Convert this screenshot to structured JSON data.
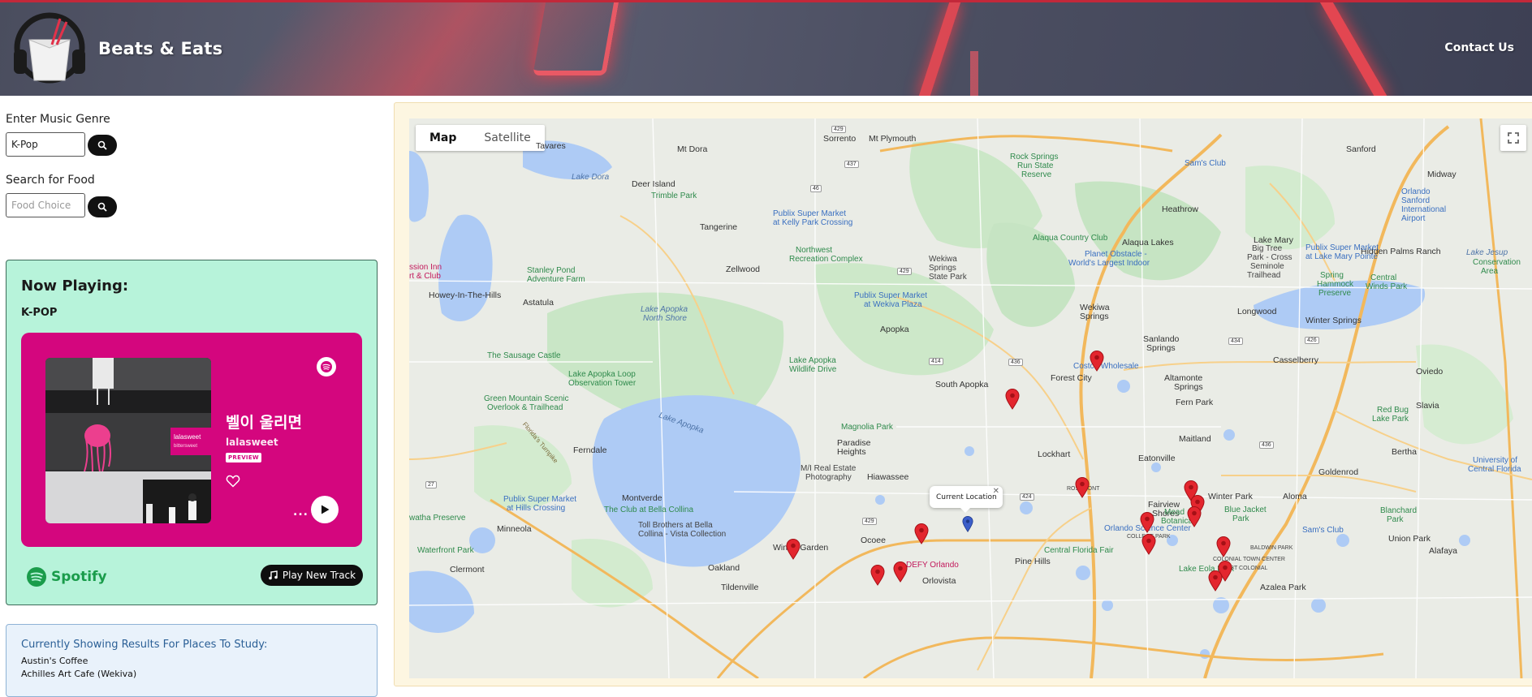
{
  "header": {
    "brand": "Beats & Eats",
    "contact": "Contact Us"
  },
  "sidebar": {
    "genre_label": "Enter Music Genre",
    "genre_value": "K-Pop",
    "food_label": "Search for Food",
    "food_placeholder": "Food Choice"
  },
  "now_playing": {
    "title": "Now Playing:",
    "genre": "K-POP",
    "track": "벨이 울리면",
    "artist": "lalasweet",
    "preview_badge": "PREVIEW",
    "album_text_1": "lalasweet",
    "album_text_2": "bittersweet",
    "more": "...",
    "spotify_brand": "Spotify",
    "play_new": "Play New Track"
  },
  "results": {
    "title": "Currently Showing Results For Places To Study:",
    "items": [
      "Austin's Coffee",
      "Achilles Art Cafe (Wekiva)"
    ]
  },
  "map": {
    "type_map": "Map",
    "type_satellite": "Satellite",
    "info_window": "Current Location",
    "info_close": "✕",
    "colors": {
      "water": "#aecbf5",
      "park": "#c4e3c4",
      "highway": "#f5c06a",
      "pin": "#e3262e"
    }
  },
  "map_labels": {
    "tavares": "Tavares",
    "mt_dora": "Mt Dora",
    "sorrento": "Sorrento",
    "mt_plymouth": "Mt Plymouth",
    "sanford": "Sanford",
    "midway": "Midway",
    "lake_dora": "Lake Dora",
    "deer_island": "Deer Island",
    "trimble_park": "Trimble Park",
    "tangerine": "Tangerine",
    "publix_kelly_1": "Publix Super Market",
    "publix_kelly_2": "at Kelly Park Crossing",
    "heathrow": "Heathrow",
    "rock_springs_1": "Rock Springs",
    "rock_springs_2": "Run State",
    "rock_springs_3": "Reserve",
    "sams_club": "Sam's Club",
    "sanford_airport_1": "Orlando",
    "sanford_airport_2": "Sanford",
    "sanford_airport_3": "International",
    "sanford_airport_4": "Airport",
    "alaqua_lakes": "Alaqua Lakes",
    "lake_mary": "Lake Mary",
    "hidden_palms": "Hidden Palms Ranch",
    "lake_jesup_1": "Lake Jesup",
    "lake_jesup_2": "Conservation",
    "lake_jesup_3": "Area",
    "zellwood": "Zellwood",
    "northwest_rec_1": "Northwest",
    "northwest_rec_2": "Recreation Complex",
    "alaqua_cc": "Alaqua Country Club",
    "wekiwa_1": "Wekiwa",
    "wekiwa_2": "Springs",
    "wekiwa_3": "State Park",
    "planet_obstacle_1": "Planet Obstacle -",
    "planet_obstacle_2": "World's Largest Indoor",
    "big_tree_1": "Big Tree",
    "big_tree_2": "Park - Cross",
    "big_tree_3": "Seminole",
    "big_tree_4": "Trailhead",
    "publix_lakemary_1": "Publix Super Market",
    "publix_lakemary_2": "at Lake Mary Pointe",
    "mission_inn_1": "ssion Inn",
    "mission_inn_2": "rt & Club",
    "stanley_pond_1": "Stanley Pond",
    "stanley_pond_2": "Adventure Farm",
    "howey": "Howey-In-The-Hills",
    "astatula": "Astatula",
    "lake_apopka_north_1": "Lake Apopka",
    "lake_apopka_north_2": "North Shore",
    "publix_wekiva_1": "Publix Super Market",
    "publix_wekiva_2": "at Wekiva Plaza",
    "spring_hammock_1": "Spring",
    "spring_hammock_2": "Hammock",
    "spring_hammock_3": "Preserve",
    "central_winds_1": "Central",
    "central_winds_2": "Winds Park",
    "wekiwa_springs_city_1": "Wekiwa",
    "wekiwa_springs_city_2": "Springs",
    "sanlando_1": "Sanlando",
    "sanlando_2": "Springs",
    "longwood": "Longwood",
    "winter_springs": "Winter Springs",
    "apopka": "Apopka",
    "sausage_castle": "The Sausage Castle",
    "lake_apopka_wild_1": "Lake Apopka",
    "lake_apopka_wild_2": "Wildlife Drive",
    "costco": "Costco Wholesale",
    "casselberry": "Casselberry",
    "oviedo": "Oviedo",
    "lake_apopka_loop_1": "Lake Apopka Loop",
    "lake_apopka_loop_2": "Observation Tower",
    "south_apopka": "South Apopka",
    "forest_city": "Forest City",
    "altamonte_1": "Altamonte",
    "altamonte_2": "Springs",
    "green_mountain_1": "Green Mountain Scenic",
    "green_mountain_2": "Overlook & Trailhead",
    "fern_park": "Fern Park",
    "slavia": "Slavia",
    "red_bug_1": "Red Bug",
    "red_bug_2": "Lake Park",
    "lake_apopka": "Lake Apopka",
    "magnolia_park": "Magnolia Park",
    "maitland": "Maitland",
    "paradise_1": "Paradise",
    "paradise_2": "Heights",
    "lockhart": "Lockhart",
    "eatonville": "Eatonville",
    "bertha": "Bertha",
    "ferndale": "Ferndale",
    "hiawassee": "Hiawassee",
    "mh_real_1": "M/I Real Estate",
    "mh_real_2": "Photography",
    "goldenrod": "Goldenrod",
    "ucf_1": "University of",
    "ucf_2": "Central Florida",
    "montverde": "Montverde",
    "club_bella": "The Club at Bella Collina",
    "publix_hills_1": "Publix Super Market",
    "publix_hills_2": "at Hills Crossing",
    "toll_bros_1": "Toll Brothers at Bella",
    "toll_bros_2": "Collina - Vista Collection",
    "winter_park": "Winter Park",
    "aloma": "Aloma",
    "blanchard_1": "Blanchard",
    "blanchard_2": "Park",
    "fairview_1": "Fairview",
    "fairview_2": "Shores",
    "mead_1": "Mead",
    "mead_2": "Botanical",
    "blue_jacket_1": "Blue Jacket",
    "blue_jacket_2": "Park",
    "watha": "watha Preserve",
    "minneola": "Minneola",
    "orlando_science": "Orlando Science Center",
    "college_park": "COLLEGE PARK",
    "sams_club_2": "Sam's Club",
    "union_park": "Union Park",
    "waterfront_park": "Waterfront Park",
    "winter_garden": "Winter Garden",
    "ocoee": "Ocoee",
    "central_fl_fair": "Central Florida Fair",
    "baldwin_park": "BALDWIN PARK",
    "alafaya": "Alafaya",
    "clermont": "Clermont",
    "oakland": "Oakland",
    "defy": "DEFY Orlando",
    "pine_hills": "Pine Hills",
    "lake_eola": "Lake Eola Park",
    "colonial_town": "COLONIAL TOWN CENTER",
    "west_colonial": "WEST COLONIAL",
    "rosemont": "ROSEMONT",
    "orlovista": "Orlovista",
    "tildenville": "Tildenville",
    "azalea_park": "Azalea Park",
    "florida_turnpike": "Florida's Turnpike",
    "lake_apopka_inner": "Lake Apopka"
  }
}
